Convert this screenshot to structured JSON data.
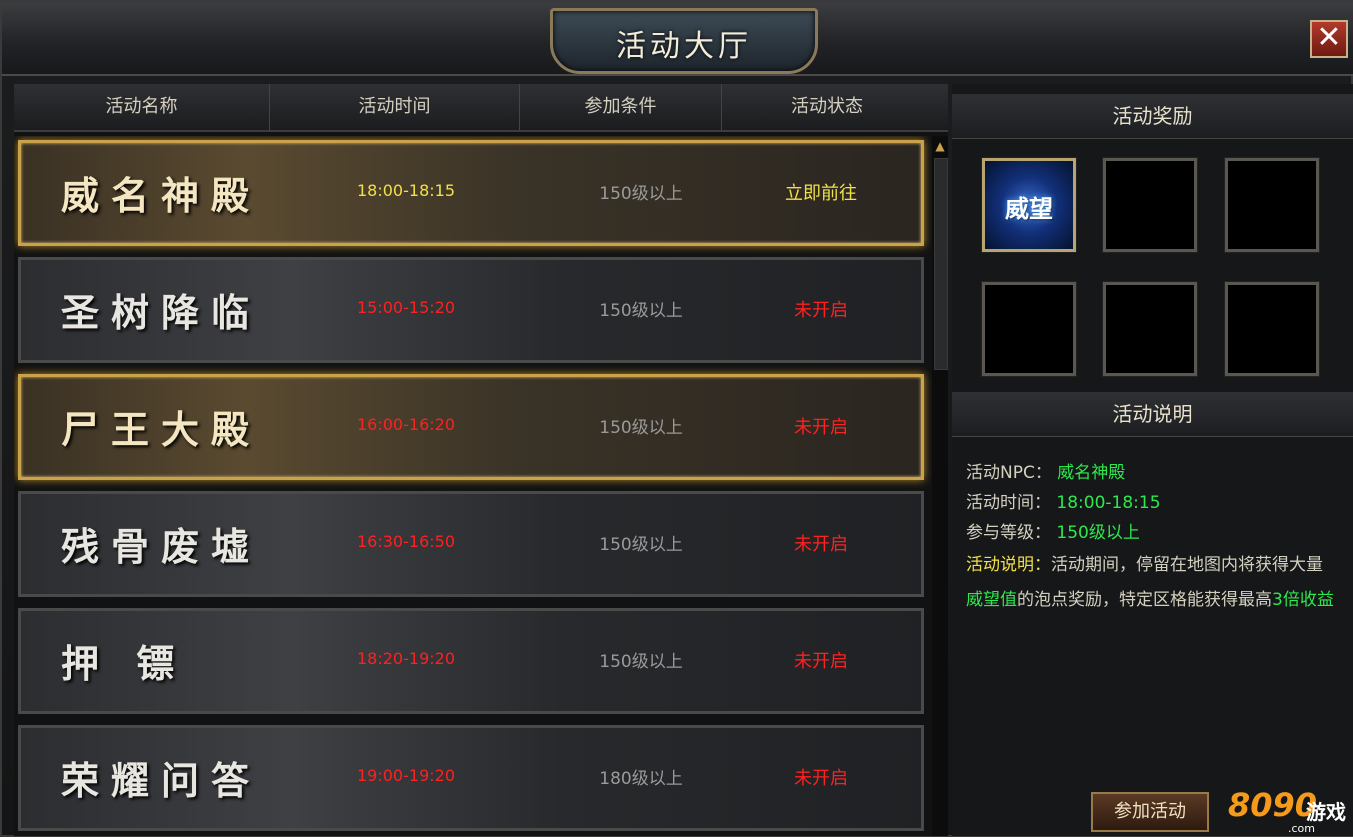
{
  "window": {
    "title": "活动大厅",
    "close_glyph": "✕"
  },
  "table": {
    "headers": [
      "活动名称",
      "活动时间",
      "参加条件",
      "活动状态"
    ],
    "rows": [
      {
        "name": "威名神殿",
        "time": "18:00-18:15",
        "condition": "150级以上",
        "status": "立即前往"
      },
      {
        "name": "圣树降临",
        "time": "15:00-15:20",
        "condition": "150级以上",
        "status": "未开启"
      },
      {
        "name": "尸王大殿",
        "time": "16:00-16:20",
        "condition": "150级以上",
        "status": "未开启"
      },
      {
        "name": "残骨废墟",
        "time": "16:30-16:50",
        "condition": "150级以上",
        "status": "未开启"
      },
      {
        "name": "押 镖",
        "time": "18:20-19:20",
        "condition": "150级以上",
        "status": "未开启"
      },
      {
        "name": "荣耀问答",
        "time": "19:00-19:20",
        "condition": "180级以上",
        "status": "未开启"
      }
    ]
  },
  "rewards": {
    "title": "活动奖励",
    "slots": [
      {
        "label": "威望"
      },
      {
        "label": ""
      },
      {
        "label": ""
      },
      {
        "label": ""
      },
      {
        "label": ""
      },
      {
        "label": ""
      }
    ]
  },
  "description": {
    "title": "活动说明",
    "npc_label": "活动NPC：",
    "npc_value": "威名神殿",
    "time_label": "活动时间：",
    "time_value": "18:00-18:15",
    "level_label": "参与等级：",
    "level_value": "150级以上",
    "desc_label": "活动说明：",
    "desc_part1": "活动期间，停留在地图内将获得大量",
    "desc_highlight": "威望值",
    "desc_part2": "的泡点奖励，特定区格能获得最高",
    "desc_multiplier": "3倍收益"
  },
  "join_button": "参加活动",
  "logo": {
    "number": "8090",
    "text": "游戏",
    "domain": ".com"
  },
  "colors": {
    "gold": "#c9a24a",
    "green": "#2ee84e",
    "yellow": "#f0e04a",
    "red": "#ff2020"
  }
}
